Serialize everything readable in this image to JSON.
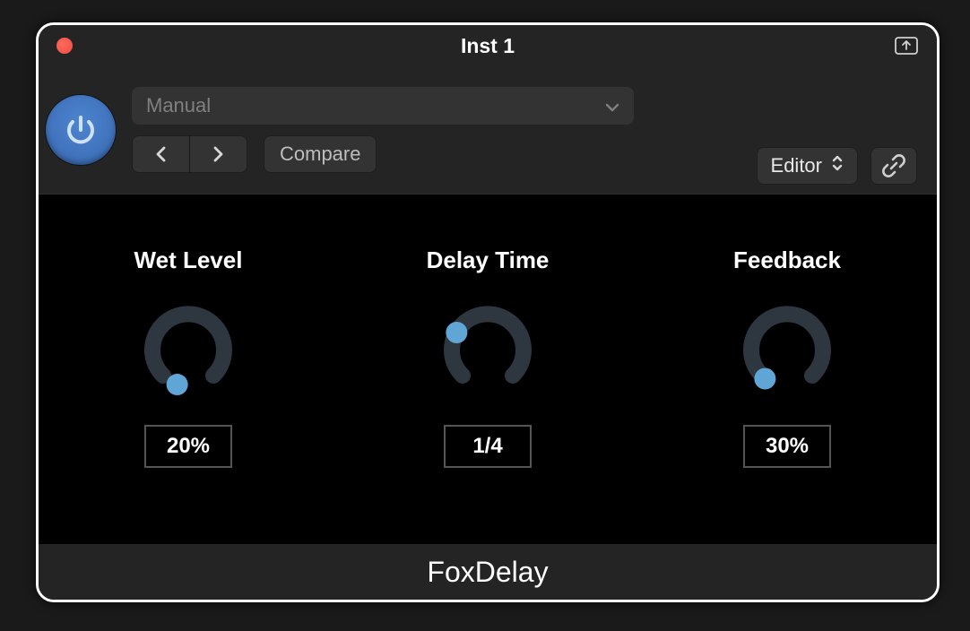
{
  "window": {
    "title": "Inst 1"
  },
  "toolbar": {
    "preset_name": "Manual",
    "compare_label": "Compare",
    "editor_label": "Editor"
  },
  "knobs": [
    {
      "label": "Wet Level",
      "value": "20%",
      "angle_deg": 198
    },
    {
      "label": "Delay Time",
      "value": "1/4",
      "angle_deg": 300
    },
    {
      "label": "Feedback",
      "value": "30%",
      "angle_deg": 218
    }
  ],
  "footer": {
    "plugin_name": "FoxDelay"
  },
  "colors": {
    "knob_track": "#2e3740",
    "knob_indicator": "#5fa6d6",
    "power_accent": "#3f74c2"
  }
}
